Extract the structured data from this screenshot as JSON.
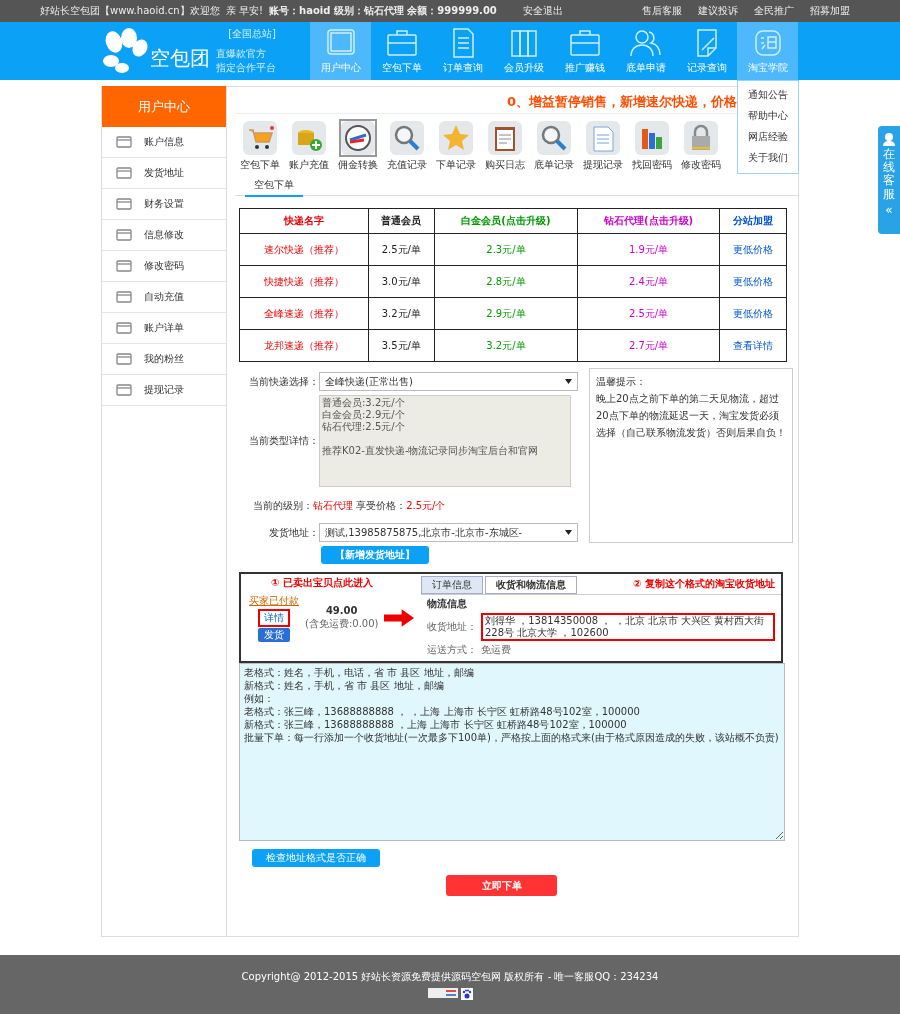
{
  "top_bar": {
    "greeting": "好站长空包团【www.haoid.cn】欢迎您  亲 早安!",
    "account": "账号：haoid 级别：钻石代理 余额：999999.00",
    "logout": "安全退出",
    "links": [
      "售后客服",
      "建议投诉",
      "全民推广",
      "招募加盟"
    ]
  },
  "header": {
    "logo": {
      "name": "空包团",
      "tag": "[全国总站]",
      "slogan_1": "直爆款官方",
      "slogan_2": "指定合作平台"
    },
    "nav": [
      {
        "label": "用户中心",
        "selected": true
      },
      {
        "label": "空包下单",
        "selected": false
      },
      {
        "label": "订单查询",
        "selected": false
      },
      {
        "label": "会员升级",
        "selected": false
      },
      {
        "label": "推广赚钱",
        "selected": false
      },
      {
        "label": "底单申请",
        "selected": false
      },
      {
        "label": "记录查询",
        "selected": false
      },
      {
        "label": "淘宝学院",
        "selected": true,
        "expanded": true,
        "menu": [
          "通知公告",
          "帮助中心",
          "网店经验",
          "关于我们"
        ]
      }
    ]
  },
  "sidebar": {
    "title": "用户中心",
    "items": [
      "账户信息",
      "发货地址",
      "财务设置",
      "信息修改",
      "修改密码",
      "自动充值",
      "账户详单",
      "我的粉丝",
      "提现记录"
    ]
  },
  "notice": "0、增益暂停销售，新增速尔快递，价格",
  "toolbar": [
    {
      "label": "空包下单",
      "selected": false
    },
    {
      "label": "账户充值",
      "selected": false
    },
    {
      "label": "佣金转换",
      "selected": true
    },
    {
      "label": "充值记录",
      "selected": false
    },
    {
      "label": "下单记录",
      "selected": false
    },
    {
      "label": "购买日志",
      "selected": false
    },
    {
      "label": "底单记录",
      "selected": false
    },
    {
      "label": "提现记录",
      "selected": false
    },
    {
      "label": "找回密码",
      "selected": false
    },
    {
      "label": "修改密码",
      "selected": false
    }
  ],
  "section_tab": "空包下单",
  "price_table": {
    "columns": [
      {
        "label": "快递名字",
        "color": "#e60000"
      },
      {
        "label": "普通会员",
        "color": "#222222"
      },
      {
        "label": "白金会员",
        "note": "(点击升级)",
        "color": "#009900"
      },
      {
        "label": "钻石代理",
        "note": "(点击升级)",
        "color": "#cc00cc"
      },
      {
        "label": "分站加盟",
        "color": "#0055cc"
      }
    ],
    "rows": [
      [
        "速尔快递（推荐）",
        "2.5元/单",
        "2.3元/单",
        "1.9元/单",
        "更低价格"
      ],
      [
        "快捷快递（推荐）",
        "3.0元/单",
        "2.8元/单",
        "2.4元/单",
        "更低价格"
      ],
      [
        "全峰速递（推荐）",
        "3.2元/单",
        "2.9元/单",
        "2.5元/单",
        "更低价格"
      ],
      [
        "龙邦速递（推荐）",
        "3.5元/单",
        "3.2元/单",
        "2.7元/单",
        "查看详情"
      ]
    ]
  },
  "form": {
    "courier_label": "当前快递选择：",
    "courier_value": "全峰快递(正常出售)",
    "detail_label": "当前类型详情：",
    "detail_lines": [
      "普通会员:3.2元/个",
      "白金会员:2.9元/个",
      "钻石代理:2.5元/个"
    ],
    "detail_note": "推荐K02-直发快递-物流记录同步淘宝后台和官网",
    "level_label": "当前的级别：",
    "level_value": "钻石代理",
    "price_label": "享受价格：",
    "price_value": "2.5元/个",
    "address_label": "发货地址：",
    "address_value": "测试,13985875875,北京市-北京市-东城区-",
    "add_address_button": "【新增发货地址】",
    "tips_title": "温馨提示：",
    "tips_text": "晚上20点之前下单的第二天见物流，超过20点下单的物流延迟一天，淘宝发货必须选择（自己联系物流发货）否则后果自负！"
  },
  "example_screenshot": {
    "step_1": "① 已卖出宝贝点此进入",
    "step_2": "② 复制这个格式的淘宝收货地址",
    "status_link": "买家已付款",
    "details_link": "详情",
    "ship_button": "发货",
    "price": "49.00",
    "shipping_note": "(含免运费:0.00)",
    "tabs": [
      {
        "label": "订单信息",
        "selected": false
      },
      {
        "label": "收货和物流信息",
        "selected": true
      }
    ],
    "section_title": "物流信息",
    "address_label": "收货地址：",
    "address_value": "刘得华 ，13814350008 ， ，北京 北京市 大兴区 黄村西大街228号 北京大学 ，102600",
    "method_label": "运送方式：",
    "method_value": "免运费"
  },
  "batch_input": {
    "placeholder_lines": [
      "老格式：姓名，手机，电话，省 市 县区 地址，邮编",
      "新格式：姓名，手机，省 市 县区 地址，邮编",
      "例如：",
      "老格式：张三峰，13688888888 ， ，上海 上海市 长宁区 虹桥路48号102室，100000",
      "新格式：张三峰，13688888888 ，上海 上海市 长宁区 虹桥路48号102室，100000",
      "批量下单：每一行添加一个收货地址(一次最多下100单)，严格按上面的格式来(由于格式原因造成的失败，该站概不负责)"
    ]
  },
  "check_button": "检查地址格式是否正确",
  "submit_button": "立即下单",
  "footer": {
    "copyright": "Copyright@ 2012-2015 好站长资源免费提供源码空包网 版权所有 - 唯一客服QQ：234234"
  },
  "side_widget": {
    "label": "在线客服",
    "chevron": "«"
  }
}
